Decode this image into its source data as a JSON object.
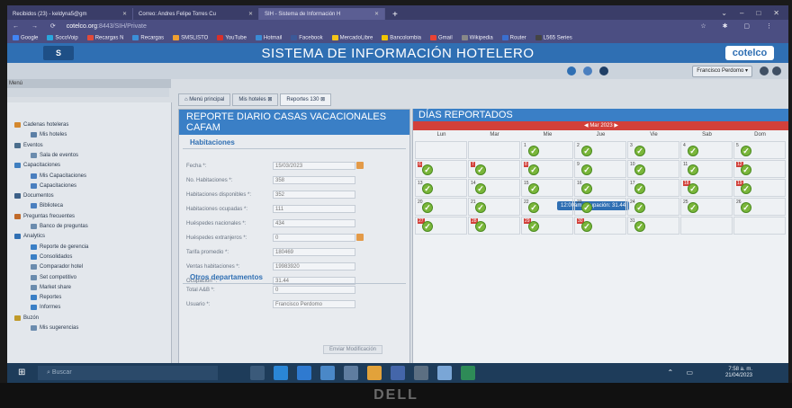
{
  "browser": {
    "tabs": [
      {
        "label": "Recibidos (23) - keldyna5@gm"
      },
      {
        "label": "Correo: Andres Felipe Torres Cu"
      },
      {
        "label": "SIH - Sistema de Información H"
      }
    ],
    "new_tab": "+",
    "window_controls": [
      "⌄",
      "–",
      "□",
      "✕"
    ],
    "url_host": "cotelco.org",
    "url_rest": ":8443/SIH/Private",
    "bookmarks": [
      "Google",
      "SocoVoip",
      "Recargas N",
      "Recargas",
      "SMSLISTO",
      "YouTube",
      "Hotmail",
      "Facebook",
      "MercadoLibre",
      "Bancolombia",
      "Gmail",
      "Wikipedia",
      "Router",
      "L565 Series"
    ]
  },
  "header": {
    "logo_left": "S",
    "system_title": "SISTEMA DE INFORMACIÓN HOTELERO",
    "logo_right": "cotelco"
  },
  "userbar": {
    "user": "Francisco Perdomo"
  },
  "sidebar": {
    "label": "Menú",
    "items": [
      {
        "label": "Cadenas hoteleras"
      },
      {
        "label": "Mis hoteles"
      },
      {
        "label": "Eventos"
      },
      {
        "label": "Sala de eventos"
      },
      {
        "label": "Capacitaciones"
      },
      {
        "label": "Mis Capacitaciones"
      },
      {
        "label": "Capacitaciones"
      },
      {
        "label": "Documentos"
      },
      {
        "label": "Biblioteca"
      },
      {
        "label": "Preguntas frecuentes"
      },
      {
        "label": "Banco de preguntas"
      },
      {
        "label": "Analytics"
      },
      {
        "label": "Reporte de gerencia"
      },
      {
        "label": "Consolidados"
      },
      {
        "label": "Comparador hotel"
      },
      {
        "label": "Set competitivo"
      },
      {
        "label": "Market share"
      },
      {
        "label": "Reportes"
      },
      {
        "label": "Informes"
      },
      {
        "label": "Buzón"
      },
      {
        "label": "Mis sugerencias"
      }
    ]
  },
  "content_tabs": [
    "Menú principal",
    "Mis hoteles",
    "Reportes 130"
  ],
  "report": {
    "title_line1": "REPORTE DIARIO CASAS VACACIONALES",
    "title_line2": "CAFAM",
    "section1": "Habitaciones",
    "fields": [
      {
        "label": "Fecha *:",
        "value": "15/03/2023"
      },
      {
        "label": "No. Habitaciones *:",
        "value": "358"
      },
      {
        "label": "Habitaciones disponibles *:",
        "value": "352"
      },
      {
        "label": "Habitaciones ocupadas *:",
        "value": "111"
      },
      {
        "label": "Huéspedes nacionales *:",
        "value": "434"
      },
      {
        "label": "Huéspedes extranjeros *:",
        "value": "0"
      },
      {
        "label": "Tarifa promedio *:",
        "value": "180469"
      },
      {
        "label": "Ventas habitaciones *:",
        "value": "19983920"
      },
      {
        "label": "Ocupación *:",
        "value": "31.44"
      }
    ],
    "section2": "Otros departamentos",
    "other_fields": [
      {
        "label": "Total A&B *:",
        "value": "0"
      },
      {
        "label": "Usuario *:",
        "value": "Francisco Perdomo"
      }
    ],
    "submit": "Enviar Modificación"
  },
  "days": {
    "title": "DÍAS REPORTADOS",
    "month": "Mar 2023",
    "weekdays": [
      "Lun",
      "Mar",
      "Mie",
      "Jue",
      "Vie",
      "Sab",
      "Dom"
    ],
    "weeks": [
      [
        null,
        null,
        "1",
        "2",
        "3",
        "4",
        "5"
      ],
      [
        "6",
        "7",
        "8",
        "9",
        "10",
        "11",
        "12"
      ],
      [
        "13",
        "14",
        "15",
        "16",
        "17",
        "18",
        "19"
      ],
      [
        "20",
        "21",
        "22",
        "23",
        "24",
        "25",
        "26"
      ],
      [
        "27",
        "28",
        "29",
        "30",
        "31",
        null,
        null
      ]
    ],
    "red_days": [
      "6",
      "7",
      "8",
      "12",
      "18",
      "19",
      "27",
      "28",
      "29",
      "30"
    ],
    "tooltip": "12:00am Ocupación: 31.44"
  },
  "taskbar": {
    "search": "Buscar",
    "time": "7:58 a. m.",
    "date": "21/04/2023"
  },
  "monitor_brand": "DELL",
  "colors": {
    "header_blue": "#2f6fb3",
    "month_red": "#d2403a",
    "check_green": "#7ab63a"
  }
}
